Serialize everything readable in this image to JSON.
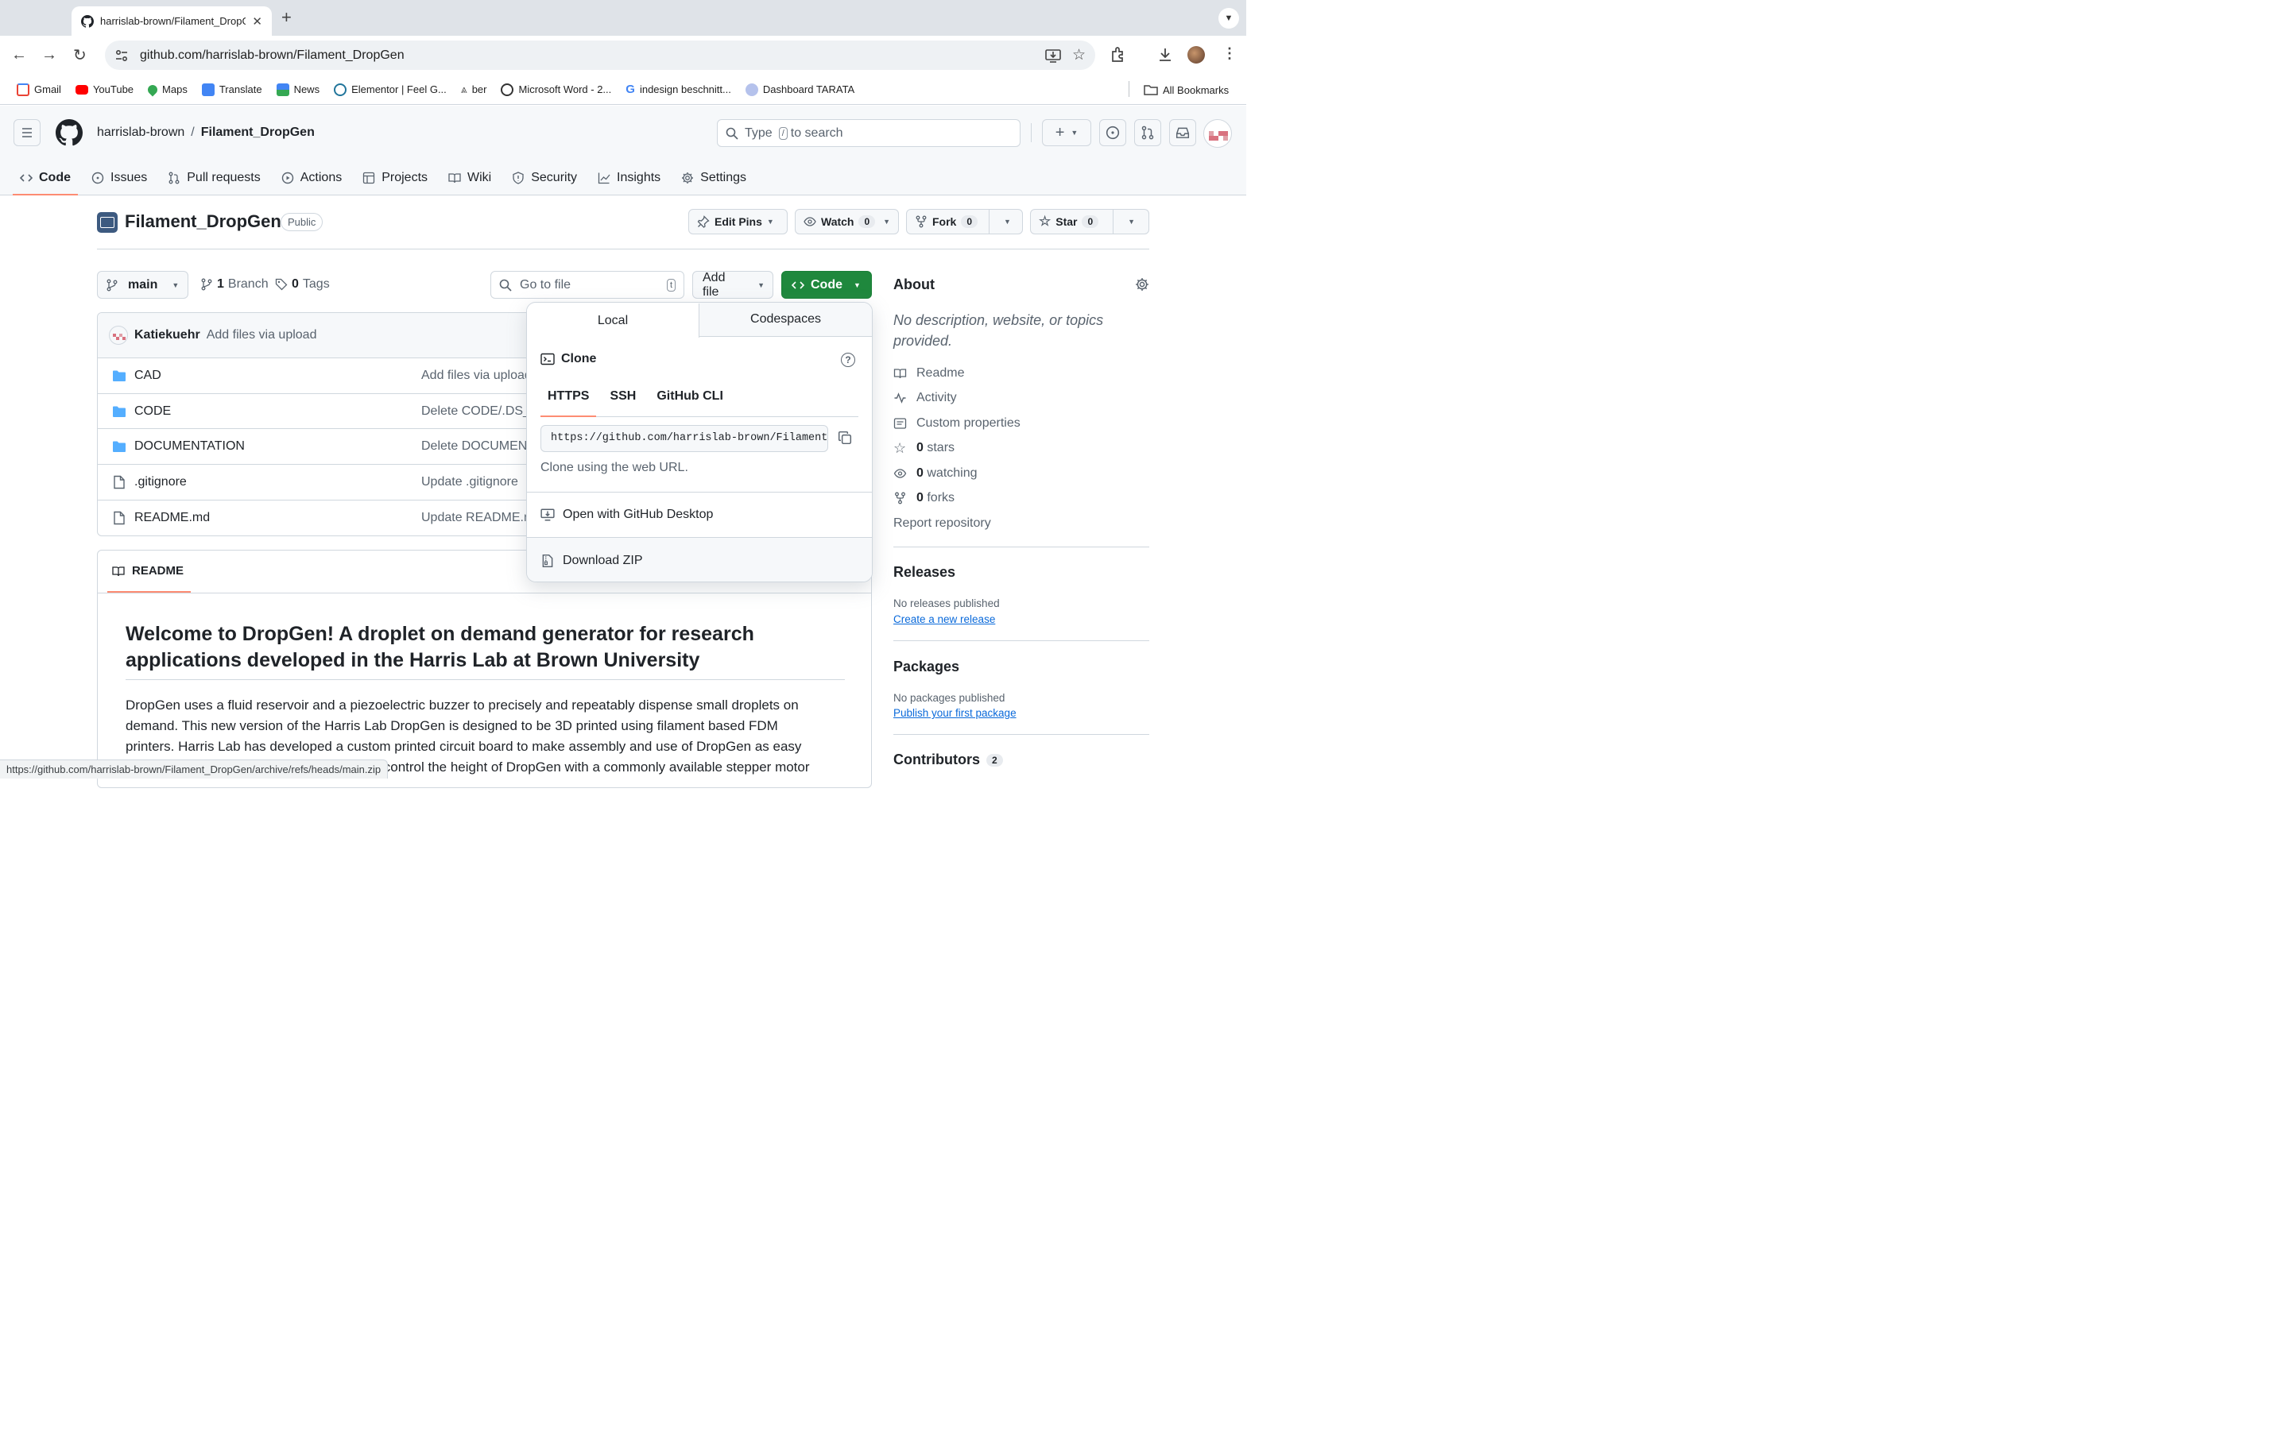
{
  "browser": {
    "tab_title": "harrislab-brown/Filament_DropGen",
    "url": "github.com/harrislab-brown/Filament_DropGen",
    "bookmarks": [
      {
        "label": "Gmail",
        "color": "#ea4335"
      },
      {
        "label": "YouTube",
        "color": "#ff0000"
      },
      {
        "label": "Maps",
        "color": "#34a853"
      },
      {
        "label": "Translate",
        "color": "#4285f4"
      },
      {
        "label": "News",
        "color": "#4285f4"
      },
      {
        "label": "Elementor | Feel G...",
        "color": "#21759b"
      },
      {
        "label": "ber",
        "color": "#555555"
      },
      {
        "label": "Microsoft Word - 2...",
        "color": "#333333"
      },
      {
        "label": "indesign beschnitt...",
        "color": "#4285f4"
      },
      {
        "label": "Dashboard TARATA",
        "color": "#7b8fd4"
      }
    ],
    "all_bookmarks": "All Bookmarks",
    "status_url": "https://github.com/harrislab-brown/Filament_DropGen/archive/refs/heads/main.zip"
  },
  "header": {
    "owner": "harrislab-brown",
    "sep": "/",
    "repo": "Filament_DropGen",
    "search_pre": "Type",
    "search_key": "/",
    "search_post": "to search"
  },
  "reponav": [
    {
      "label": "Code",
      "icon": "code-icon",
      "active": true
    },
    {
      "label": "Issues",
      "icon": "issue-icon"
    },
    {
      "label": "Pull requests",
      "icon": "pull-request-icon"
    },
    {
      "label": "Actions",
      "icon": "play-icon"
    },
    {
      "label": "Projects",
      "icon": "table-icon"
    },
    {
      "label": "Wiki",
      "icon": "book-icon"
    },
    {
      "label": "Security",
      "icon": "shield-icon"
    },
    {
      "label": "Insights",
      "icon": "graph-icon"
    },
    {
      "label": "Settings",
      "icon": "gear-icon"
    }
  ],
  "repo": {
    "name": "Filament_DropGen",
    "visibility": "Public",
    "edit_pins": "Edit Pins",
    "watch": "Watch",
    "watch_count": "0",
    "fork": "Fork",
    "fork_count": "0",
    "star": "Star",
    "star_count": "0"
  },
  "toolbar": {
    "branch": "main",
    "branches_n": "1",
    "branches_label": "Branch",
    "tags_n": "0",
    "tags_label": "Tags",
    "goto_placeholder": "Go to file",
    "goto_key": "t",
    "add_file": "Add file",
    "code": "Code"
  },
  "commit": {
    "author": "Katiekuehr",
    "message": "Add files via upload"
  },
  "files": [
    {
      "name": "CAD",
      "type": "folder",
      "message": "Add files via upload"
    },
    {
      "name": "CODE",
      "type": "folder",
      "message": "Delete CODE/.DS_Store"
    },
    {
      "name": "DOCUMENTATION",
      "type": "folder",
      "message": "Delete DOCUMENTATION"
    },
    {
      "name": ".gitignore",
      "type": "file",
      "message": "Update .gitignore"
    },
    {
      "name": "README.md",
      "type": "file",
      "message": "Update README.md"
    }
  ],
  "popover": {
    "tab_local": "Local",
    "tab_codespaces": "Codespaces",
    "clone": "Clone",
    "proto_https": "HTTPS",
    "proto_ssh": "SSH",
    "proto_cli": "GitHub CLI",
    "clone_url": "https://github.com/harrislab-brown/Filament_DropGen.git",
    "clone_hint": "Clone using the web URL.",
    "open_desktop": "Open with GitHub Desktop",
    "download_zip": "Download ZIP"
  },
  "readme": {
    "tab": "README",
    "title": "Welcome to DropGen! A droplet on demand generator for research applications developed in the Harris Lab at Brown University",
    "line1": "DropGen uses a fluid reservoir and a piezoelectric buzzer to precisely and repeatably dispense small droplets on",
    "line2": "demand. This new version of the Harris Lab DropGen is designed to be 3D printed using filament based FDM",
    "line3": "printers. Harris Lab has developed a custom printed circuit board to make assembly and use of DropGen as easy",
    "line4": "as possible. Additionally, you can precisely control the height of DropGen with a commonly available stepper motor"
  },
  "about": {
    "title": "About",
    "description": "No description, website, or topics provided.",
    "readme": "Readme",
    "activity": "Activity",
    "custom_props": "Custom properties",
    "stars_n": "0",
    "stars_label": "stars",
    "watching_n": "0",
    "watching_label": "watching",
    "forks_n": "0",
    "forks_label": "forks",
    "report": "Report repository"
  },
  "releases": {
    "title": "Releases",
    "none": "No releases published",
    "link": "Create a new release"
  },
  "packages": {
    "title": "Packages",
    "none": "No packages published",
    "link": "Publish your first package"
  },
  "contributors": {
    "title": "Contributors",
    "count": "2"
  }
}
